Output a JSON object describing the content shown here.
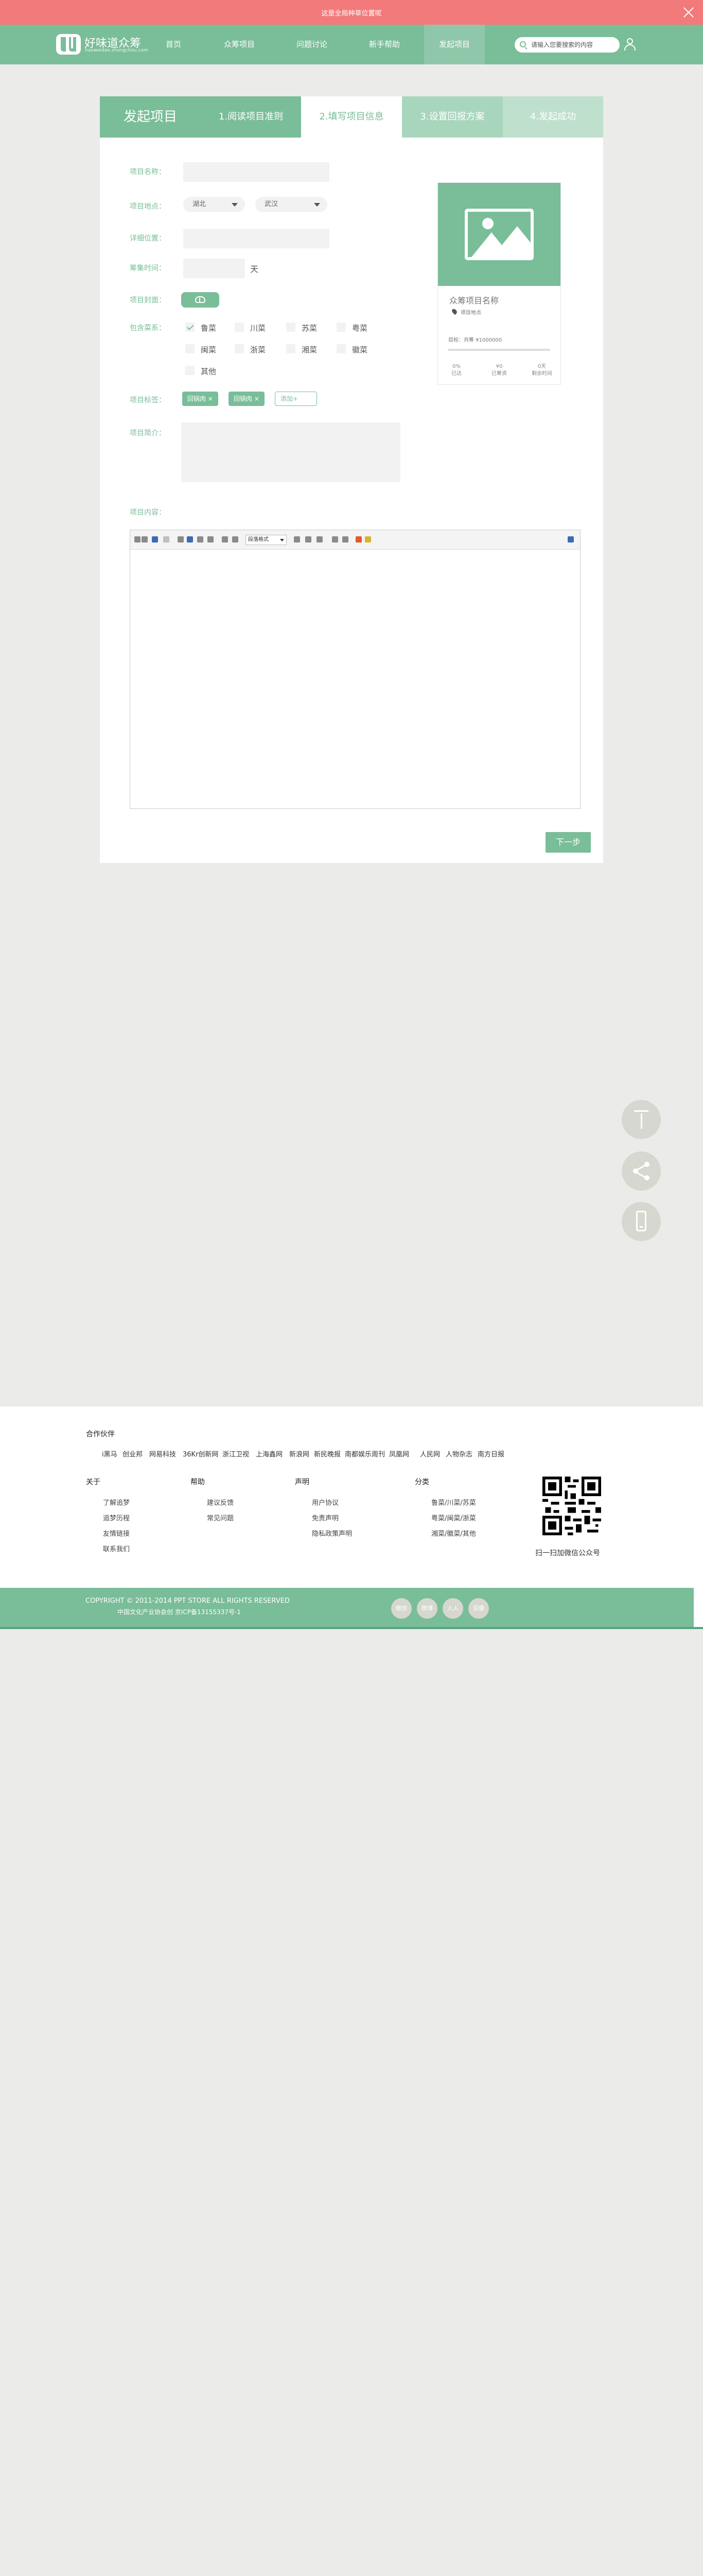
{
  "notice": {
    "text": "这是全局种草位置呢"
  },
  "brand": {
    "name": "好味道众筹",
    "url": "haoweidao.zhongchou.com"
  },
  "nav": {
    "items": [
      {
        "label": "首页"
      },
      {
        "label": "众筹项目"
      },
      {
        "label": "问题讨论"
      },
      {
        "label": "新手帮助"
      },
      {
        "label": "发起项目",
        "active": true
      }
    ]
  },
  "search": {
    "placeholder": "请输入您要搜索的内容"
  },
  "steps": {
    "main": "发起项目",
    "items": [
      "1.阅读项目准则",
      "2.填写项目信息",
      "3.设置回报方案",
      "4.发起成功"
    ]
  },
  "form": {
    "name_label": "项目名称：",
    "location_label": "项目地点：",
    "province": "湖北",
    "city": "武汉",
    "address_label": "详细位置：",
    "days_label": "筹集时间：",
    "days_unit": "天",
    "cover_label": "项目封面：",
    "cuisine_label": "包含菜系：",
    "cuisines": [
      {
        "label": "鲁菜",
        "checked": true
      },
      {
        "label": "川菜",
        "checked": false
      },
      {
        "label": "苏菜",
        "checked": false
      },
      {
        "label": "粤菜",
        "checked": false
      },
      {
        "label": "闽菜",
        "checked": false
      },
      {
        "label": "浙菜",
        "checked": false
      },
      {
        "label": "湘菜",
        "checked": false
      },
      {
        "label": "徽菜",
        "checked": false
      },
      {
        "label": "其他",
        "checked": false
      }
    ],
    "tag_label": "项目标签：",
    "tags": [
      "回锅肉 ×",
      "回锅肉 ×"
    ],
    "add_tag": "添加+",
    "intro_label": "项目简介：",
    "content_label": "项目内容："
  },
  "preview": {
    "name": "众筹项目名称",
    "location": "项目地点",
    "target": "目标：共筹 ¥1000000",
    "progress_pct": 0,
    "stats": [
      {
        "value": "0%",
        "label": "已达"
      },
      {
        "value": "¥0",
        "label": "已筹资"
      },
      {
        "value": "0天",
        "label": "剩余时间"
      }
    ]
  },
  "editor": {
    "format_label": "段落格式"
  },
  "next_button": "下一步",
  "footer": {
    "partners_title": "合作伙伴",
    "partners": [
      "i黑马",
      "创业邦",
      "网易科技",
      "36Kr创新网",
      "浙江卫视",
      "上海鑫网",
      "新浪网",
      "新民晚报",
      "南都娱乐周刊",
      "凤凰网",
      "人民网",
      "人物杂志",
      "南方日报"
    ],
    "columns": [
      {
        "title": "关于",
        "links": [
          "了解追梦",
          "追梦历程",
          "友情链接",
          "联系我们"
        ]
      },
      {
        "title": "帮助",
        "links": [
          "建议反馈",
          "常见问题"
        ]
      },
      {
        "title": "声明",
        "links": [
          "用户协议",
          "免责声明",
          "隐私政策声明"
        ]
      },
      {
        "title": "分类",
        "links": [
          "鲁菜/川菜/苏菜",
          "粤菜/闽菜/浙菜",
          "湘菜/徽菜/其他"
        ]
      }
    ],
    "qr_caption": "扫一扫加微信公众号",
    "copyright": "COPYRIGHT © 2011-2014 PPT STORE ALL RIGHTS RESERVED",
    "icp": "中国文化产业协会创 京ICP备13155337号-1",
    "social": [
      "微信",
      "微博",
      "人人",
      "豆瓣"
    ]
  },
  "colors": {
    "brand": "#7abd99",
    "notice": "#f37a7a",
    "step_light": "#a8d6bd"
  }
}
